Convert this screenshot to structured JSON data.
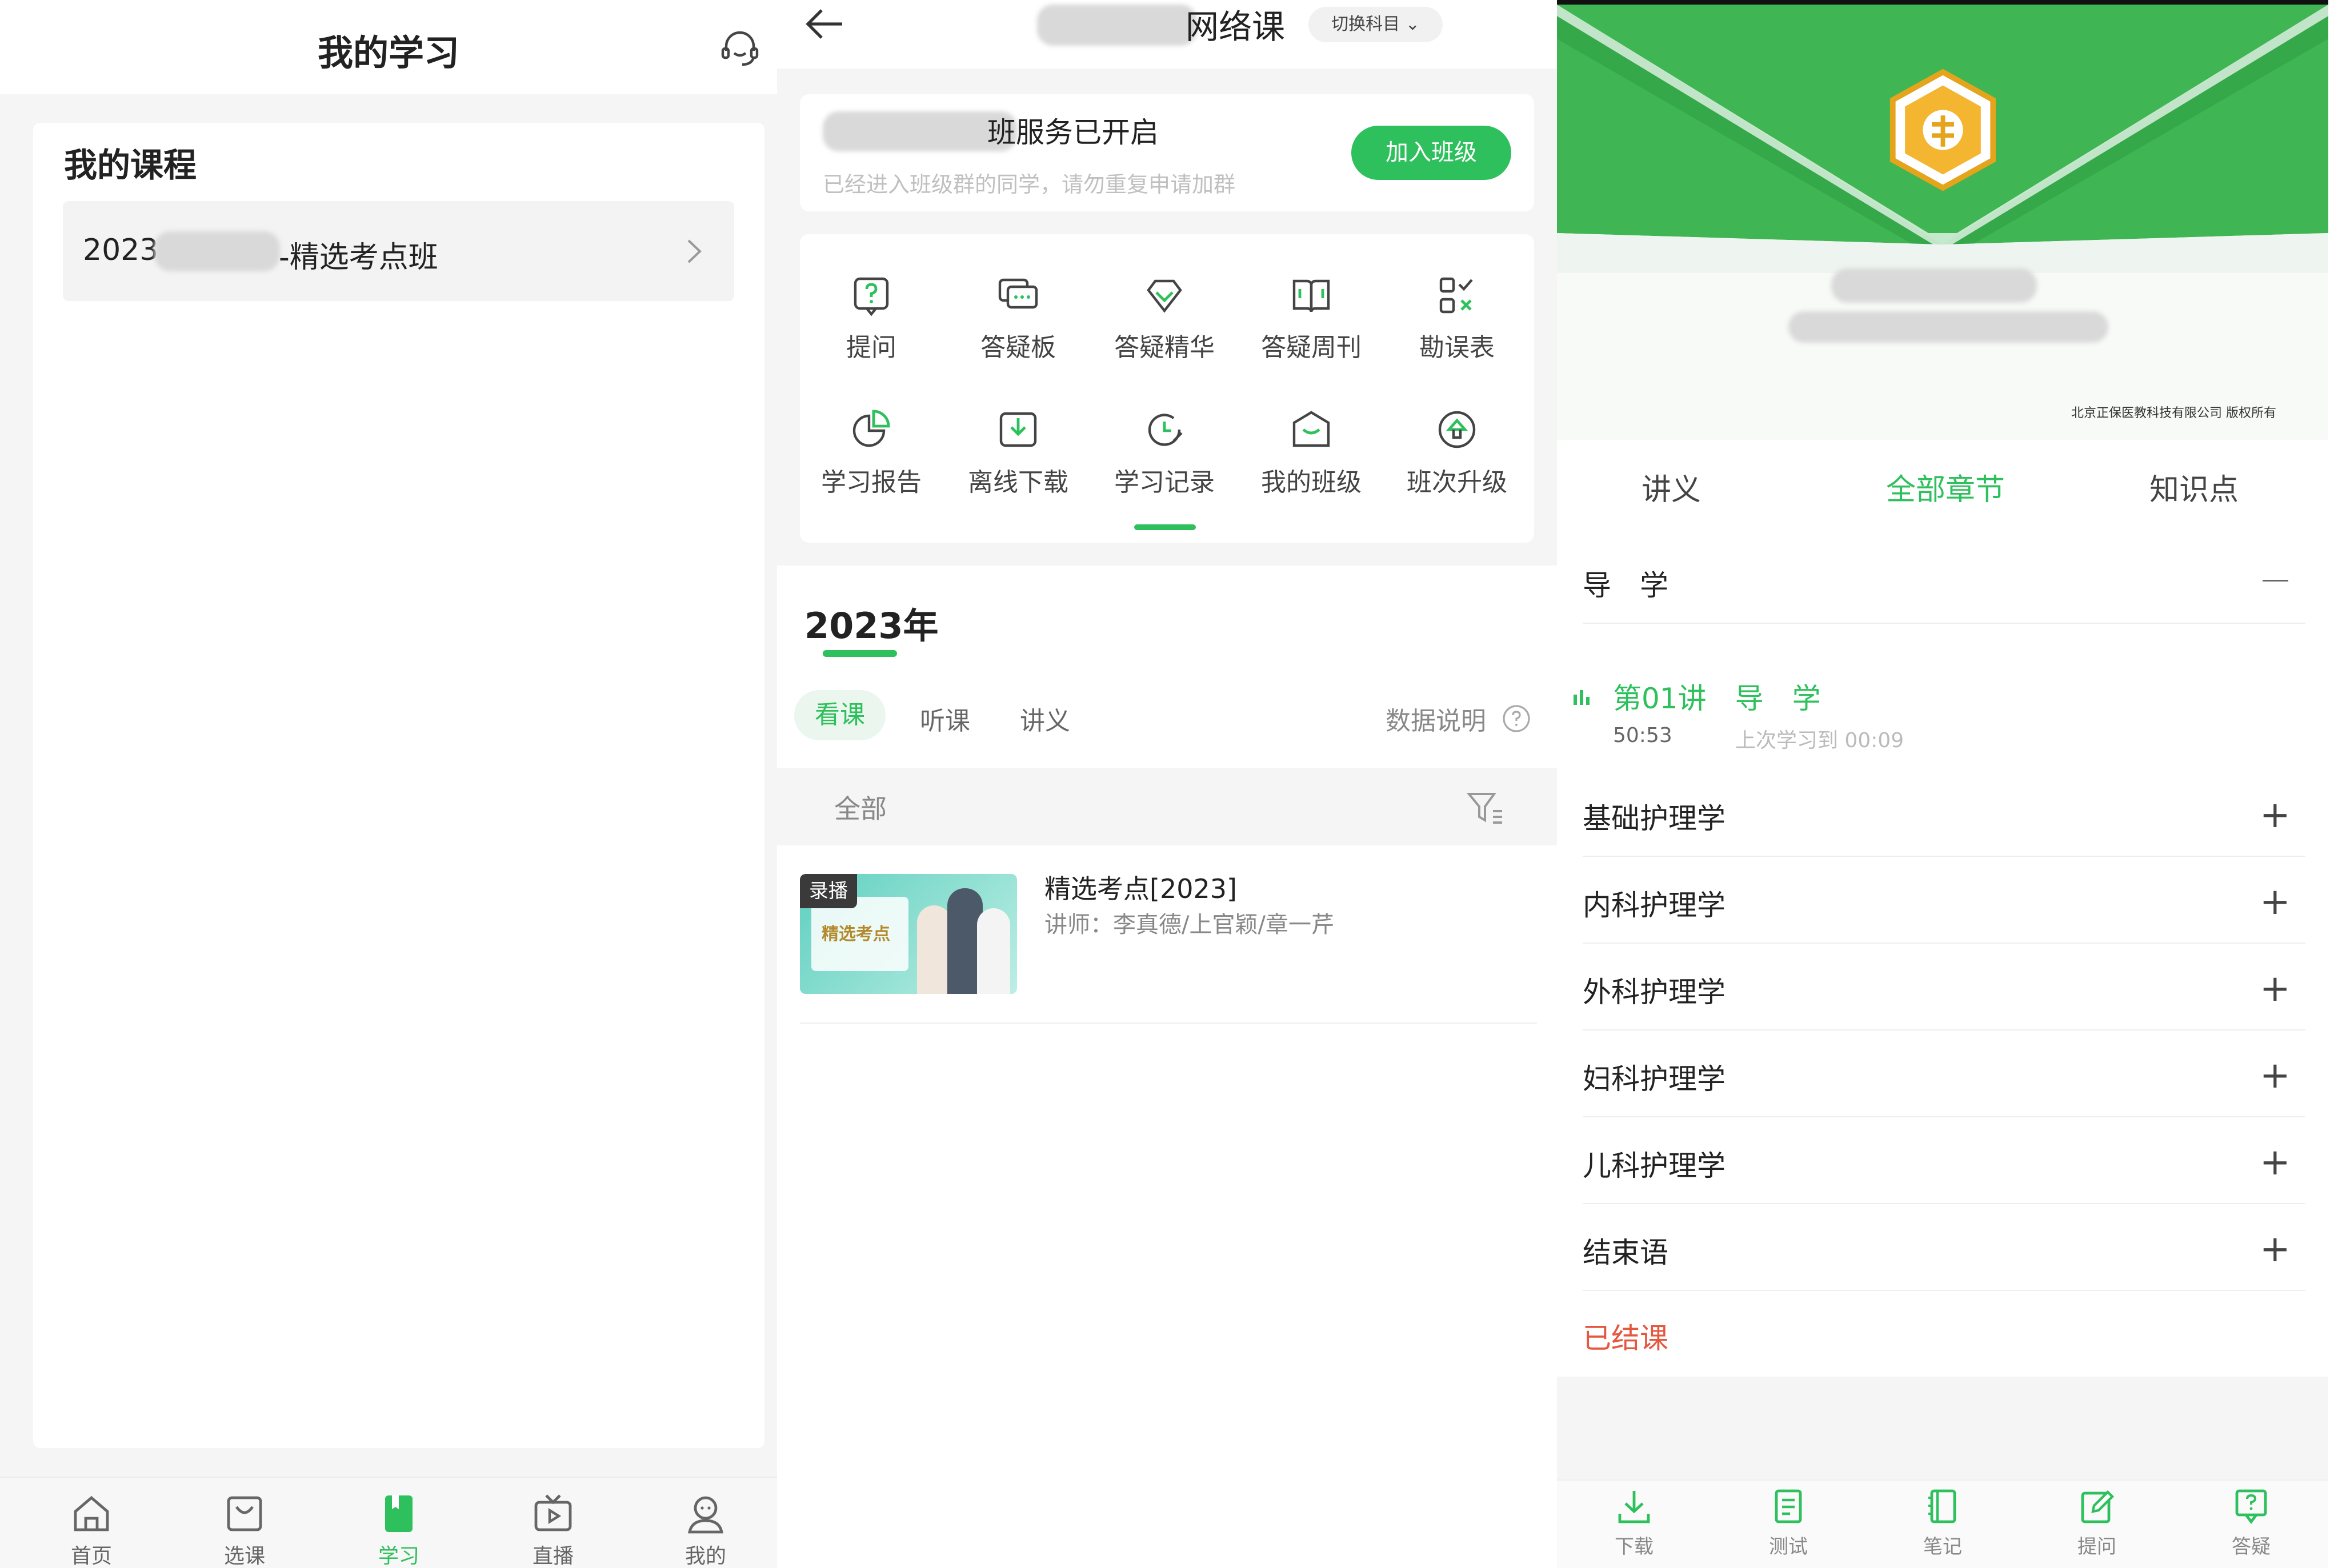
{
  "colors": {
    "accent": "#2ec05c",
    "red": "#e5573f",
    "gray_bg": "#f5f5f5"
  },
  "left": {
    "title": "我的学习",
    "section_title": "我的课程",
    "course_prefix": "2023",
    "course_suffix": "-精选考点班",
    "tabs": [
      {
        "label": "首页",
        "icon": "home-icon"
      },
      {
        "label": "选课",
        "icon": "bag-icon"
      },
      {
        "label": "学习",
        "icon": "book-icon"
      },
      {
        "label": "直播",
        "icon": "tv-icon"
      },
      {
        "label": "我的",
        "icon": "user-icon"
      }
    ]
  },
  "middle": {
    "title_suffix": "网络课",
    "switch_label": "切换科目",
    "banner_text": "班服务已开启",
    "banner_sub": "已经进入班级群的同学，请勿重复申请加群",
    "join_button": "加入班级",
    "grid": [
      {
        "label": "提问",
        "icon": "question-icon"
      },
      {
        "label": "答疑板",
        "icon": "chat-icon"
      },
      {
        "label": "答疑精华",
        "icon": "diamond-icon"
      },
      {
        "label": "答疑周刊",
        "icon": "open-book-icon"
      },
      {
        "label": "勘误表",
        "icon": "checklist-icon"
      },
      {
        "label": "学习报告",
        "icon": "pie-icon"
      },
      {
        "label": "离线下载",
        "icon": "download-icon"
      },
      {
        "label": "学习记录",
        "icon": "clock-icon"
      },
      {
        "label": "我的班级",
        "icon": "class-icon"
      },
      {
        "label": "班次升级",
        "icon": "upgrade-icon"
      }
    ],
    "year": "2023年",
    "tabs": [
      "看课",
      "听课",
      "讲义"
    ],
    "data_note": "数据说明",
    "filter_label": "全部",
    "course": {
      "badge": "录播",
      "thumb_text": "精选考点",
      "title": "精选考点[2023]",
      "teacher": "讲师：李真德/上官颖/章一芹"
    }
  },
  "right": {
    "copyright": "北京正保医教科技有限公司 版权所有",
    "tabs": [
      "讲义",
      "全部章节",
      "知识点"
    ],
    "section_open": "导　学",
    "lecture_title": "第01讲　导　学",
    "lecture_duration": "50:53",
    "lecture_last": "上次学习到 00:09",
    "sections": [
      "基础护理学",
      "内科护理学",
      "外科护理学",
      "妇科护理学",
      "儿科护理学",
      "结束语"
    ],
    "finished": "已结课",
    "bottom": [
      {
        "label": "下载",
        "icon": "download-icon"
      },
      {
        "label": "测试",
        "icon": "test-icon"
      },
      {
        "label": "笔记",
        "icon": "note-icon"
      },
      {
        "label": "提问",
        "icon": "edit-icon"
      },
      {
        "label": "答疑",
        "icon": "answer-icon"
      }
    ]
  }
}
